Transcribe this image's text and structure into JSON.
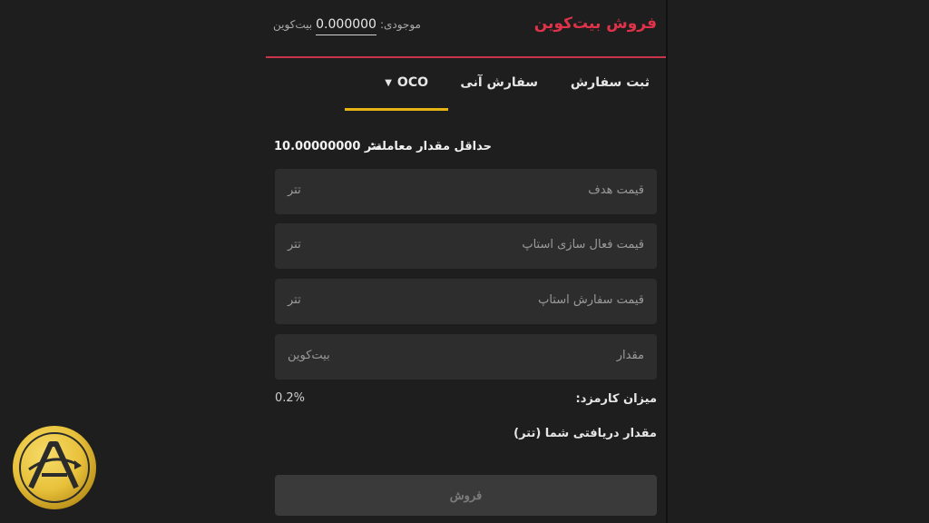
{
  "header": {
    "title": "فروش بیت‌کوین",
    "balance_label": "موجودی:",
    "balance_amount": "0.000000",
    "balance_unit": "بیت‌کوین"
  },
  "tabs": [
    {
      "label": "ثبت سفارش"
    },
    {
      "label": "سفارش آنی"
    },
    {
      "label": "OCO",
      "active": true
    }
  ],
  "min_trade": {
    "label": "حداقل مقدار معامله:",
    "value": "10.00000000 تتر"
  },
  "fields": [
    {
      "placeholder": "قیمت هدف",
      "unit": "تتر"
    },
    {
      "placeholder": "قیمت فعال سازی استاپ",
      "unit": "تتر"
    },
    {
      "placeholder": "قیمت سفارش استاپ",
      "unit": "تتر"
    },
    {
      "placeholder": "مقدار",
      "unit": "بیت‌کوین"
    }
  ],
  "fee": {
    "label": "میزان کارمزد:",
    "value": "0.2%"
  },
  "receive": {
    "label": "مقدار دریافتی شما (تتر)"
  },
  "sell_button": {
    "label": "فروش"
  },
  "colors": {
    "accent_red": "#e0334a",
    "tab_underline": "#e6b415",
    "logo_gold": "#e8c13a"
  }
}
